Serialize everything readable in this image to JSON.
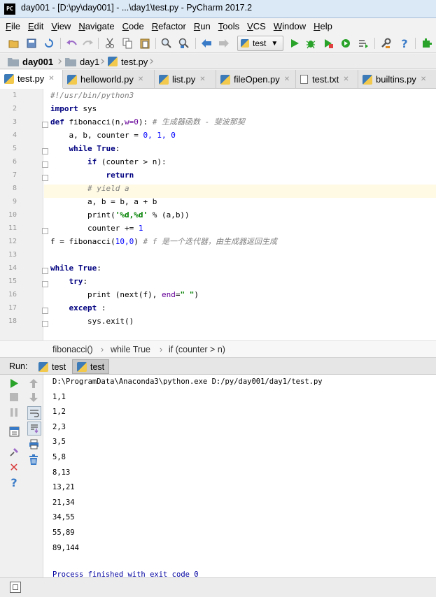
{
  "window": {
    "title": "day001 - [D:\\py\\day001] - ...\\day1\\test.py - PyCharm 2017.2",
    "logo_text": "PC"
  },
  "menu": [
    "File",
    "Edit",
    "View",
    "Navigate",
    "Code",
    "Refactor",
    "Run",
    "Tools",
    "VCS",
    "Window",
    "Help"
  ],
  "toolbar": {
    "run_config": "test",
    "icons": [
      "open-folder-icon",
      "save-icon",
      "sync-icon",
      "undo-icon",
      "redo-icon",
      "cut-icon",
      "copy-icon",
      "paste-icon",
      "find-icon",
      "replace-icon",
      "back-icon",
      "forward-icon",
      "run-icon",
      "debug-icon",
      "coverage-icon",
      "profile-icon",
      "concurrency-icon",
      "settings-icon",
      "help-icon",
      "plugin-icon"
    ]
  },
  "breadcrumb": {
    "project": "day001",
    "folder": "day1",
    "file": "test.py"
  },
  "tabs": [
    {
      "label": "test.py",
      "type": "py",
      "active": true
    },
    {
      "label": "helloworld.py",
      "type": "py",
      "active": false
    },
    {
      "label": "list.py",
      "type": "py",
      "active": false
    },
    {
      "label": "fileOpen.py",
      "type": "py",
      "active": false
    },
    {
      "label": "test.txt",
      "type": "txt",
      "active": false
    },
    {
      "label": "builtins.py",
      "type": "py",
      "active": false
    }
  ],
  "code": {
    "line_numbers": [
      "1",
      "2",
      "3",
      "4",
      "5",
      "6",
      "7",
      "8",
      "9",
      "10",
      "11",
      "12",
      "13",
      "14",
      "15",
      "16",
      "17",
      "18"
    ],
    "l1": "#!/usr/bin/python3",
    "l2_kw": "import",
    "l2_rest": " sys",
    "l3_kw": "def",
    "l3_name": " fibonacci(n,",
    "l3_param": "w=0",
    "l3_close": "):",
    "l3_cm": " # 生成器函数 - 斐波那契",
    "l4_a": "    a, b, counter = ",
    "l4_n": "0, 1, 0",
    "l5_kw": "    while True",
    "l5_p": ":",
    "l6_a": "        ",
    "l6_kw": "if",
    "l6_b": " (counter > n):",
    "l7_kw": "            return",
    "l8_cm": "        # yield a",
    "l9": "        a, b = b, a + b",
    "l10_a": "        print(",
    "l10_st": "'%d,%d'",
    "l10_b": " % (a,b))",
    "l11_a": "        counter += ",
    "l11_n": "1",
    "l12_a": "f = fibonacci(",
    "l12_n": "10,0",
    "l12_b": ") ",
    "l12_cm": "# f 是一个迭代器，由生成器返回生成",
    "l14_kw": "while True",
    "l14_p": ":",
    "l15_kw": "    try",
    "l15_p": ":",
    "l16_a": "        print (next(f), ",
    "l16_kw": "end",
    "l16_b": "=",
    "l16_st": "\" \"",
    "l16_c": ")",
    "l17_kw": "    except",
    "l17_p": " :",
    "l18": "        sys.exit()"
  },
  "structure_crumbs": [
    "fibonacci()",
    "while True",
    "if (counter > n)"
  ],
  "run": {
    "label": "Run:",
    "tabs": [
      "test",
      "test"
    ],
    "command": "D:\\ProgramData\\Anaconda3\\python.exe D:/py/day001/day1/test.py",
    "output": [
      "1,1",
      "1,2",
      "2,3",
      "3,5",
      "5,8",
      "8,13",
      "13,21",
      "21,34",
      "34,55",
      "55,89",
      "89,144"
    ],
    "finish": "Process finished with exit code 0"
  },
  "colors": {
    "keyword": "#000080",
    "string": "#008000",
    "number": "#0000ff",
    "comment": "#808080",
    "run_green": "#2aa32a"
  }
}
